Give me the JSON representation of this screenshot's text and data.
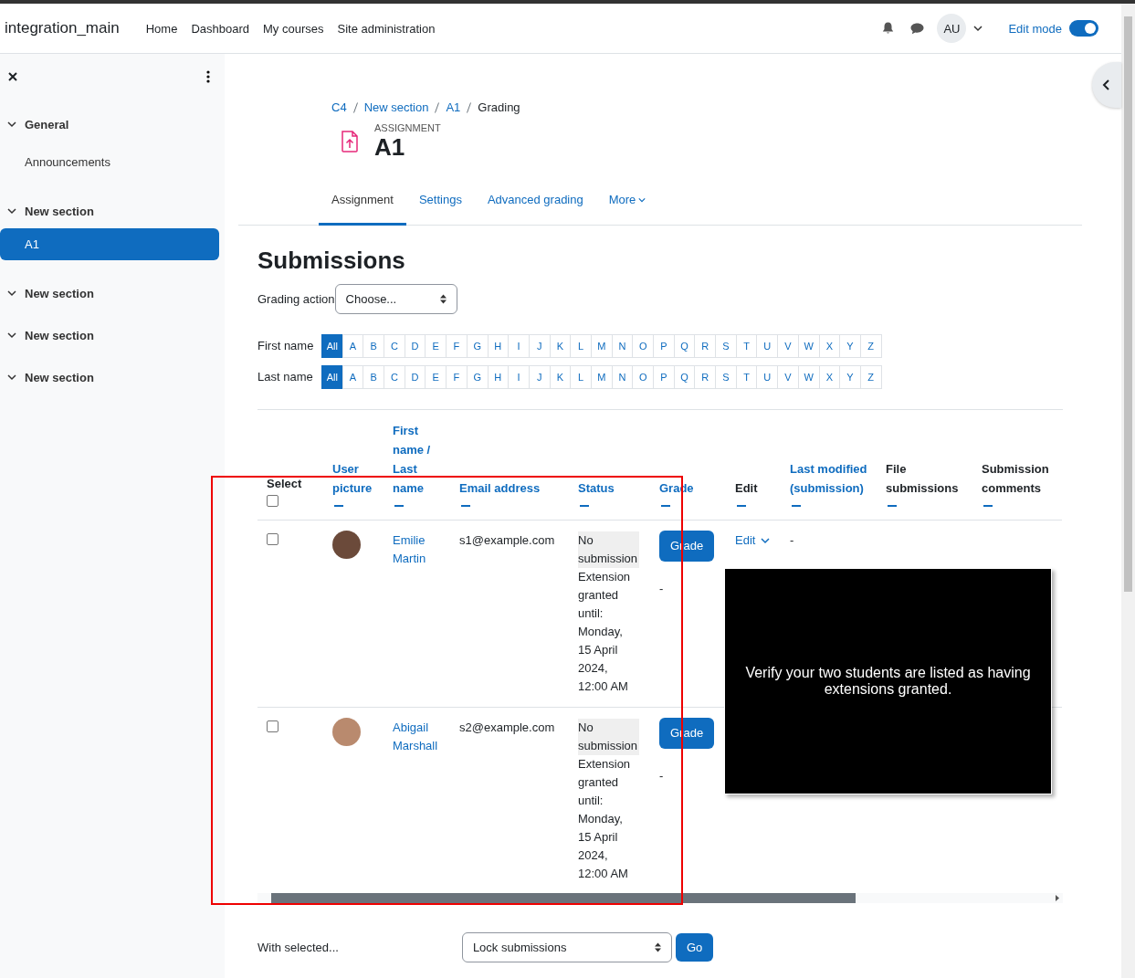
{
  "site_name": "integration_main",
  "nav": [
    "Home",
    "Dashboard",
    "My courses",
    "Site administration"
  ],
  "user_initials": "AU",
  "edit_mode": {
    "label": "Edit mode",
    "on": true
  },
  "sidebar": {
    "sections": [
      {
        "title": "General",
        "expanded": true,
        "items": [
          {
            "label": "Announcements",
            "selected": false
          }
        ]
      },
      {
        "title": "New section",
        "expanded": true,
        "items": [
          {
            "label": "A1",
            "selected": true
          }
        ]
      },
      {
        "title": "New section",
        "expanded": true
      },
      {
        "title": "New section",
        "expanded": true
      },
      {
        "title": "New section",
        "expanded": true
      }
    ]
  },
  "breadcrumb": [
    "C4",
    "New section",
    "A1",
    "Grading"
  ],
  "activity": {
    "type_label": "ASSIGNMENT",
    "title": "A1"
  },
  "tabs": [
    {
      "label": "Assignment",
      "selected": true,
      "kind": "link"
    },
    {
      "label": "Settings",
      "selected": false,
      "kind": "link"
    },
    {
      "label": "Advanced grading",
      "selected": false,
      "kind": "link"
    },
    {
      "label": "More",
      "selected": false,
      "kind": "dropdown"
    }
  ],
  "heading": "Submissions",
  "grading_action": {
    "label": "Grading action",
    "value": "Choose..."
  },
  "filters": [
    {
      "label": "First name",
      "options": [
        {
          "label": "All",
          "selected": true
        },
        {
          "label": "A",
          "selected": false
        },
        {
          "label": "B",
          "selected": false
        },
        {
          "label": "C",
          "selected": false
        },
        {
          "label": "D",
          "selected": false
        },
        {
          "label": "E",
          "selected": false
        },
        {
          "label": "F",
          "selected": false
        },
        {
          "label": "G",
          "selected": false
        },
        {
          "label": "H",
          "selected": false
        },
        {
          "label": "I",
          "selected": false
        },
        {
          "label": "J",
          "selected": false
        },
        {
          "label": "K",
          "selected": false
        },
        {
          "label": "L",
          "selected": false
        },
        {
          "label": "M",
          "selected": false
        },
        {
          "label": "N",
          "selected": false
        },
        {
          "label": "O",
          "selected": false
        },
        {
          "label": "P",
          "selected": false
        },
        {
          "label": "Q",
          "selected": false
        },
        {
          "label": "R",
          "selected": false
        },
        {
          "label": "S",
          "selected": false
        },
        {
          "label": "T",
          "selected": false
        },
        {
          "label": "U",
          "selected": false
        },
        {
          "label": "V",
          "selected": false
        },
        {
          "label": "W",
          "selected": false
        },
        {
          "label": "X",
          "selected": false
        },
        {
          "label": "Y",
          "selected": false
        },
        {
          "label": "Z",
          "selected": false
        }
      ]
    },
    {
      "label": "Last name",
      "options": [
        {
          "label": "All",
          "selected": true
        },
        {
          "label": "A",
          "selected": false
        },
        {
          "label": "B",
          "selected": false
        },
        {
          "label": "C",
          "selected": false
        },
        {
          "label": "D",
          "selected": false
        },
        {
          "label": "E",
          "selected": false
        },
        {
          "label": "F",
          "selected": false
        },
        {
          "label": "G",
          "selected": false
        },
        {
          "label": "H",
          "selected": false
        },
        {
          "label": "I",
          "selected": false
        },
        {
          "label": "J",
          "selected": false
        },
        {
          "label": "K",
          "selected": false
        },
        {
          "label": "L",
          "selected": false
        },
        {
          "label": "M",
          "selected": false
        },
        {
          "label": "N",
          "selected": false
        },
        {
          "label": "O",
          "selected": false
        },
        {
          "label": "P",
          "selected": false
        },
        {
          "label": "Q",
          "selected": false
        },
        {
          "label": "R",
          "selected": false
        },
        {
          "label": "S",
          "selected": false
        },
        {
          "label": "T",
          "selected": false
        },
        {
          "label": "U",
          "selected": false
        },
        {
          "label": "V",
          "selected": false
        },
        {
          "label": "W",
          "selected": false
        },
        {
          "label": "X",
          "selected": false
        },
        {
          "label": "Y",
          "selected": false
        },
        {
          "label": "Z",
          "selected": false
        }
      ]
    }
  ],
  "table": {
    "select_all_checked": false,
    "columns": [
      {
        "label": "Select",
        "kind": "select"
      },
      {
        "label": "User picture",
        "kind": "data",
        "sortable": true
      },
      {
        "label": "First name / Last name",
        "kind": "data",
        "sortable": true
      },
      {
        "label": "Email address",
        "kind": "data",
        "sortable": true
      },
      {
        "label": "Status",
        "kind": "data",
        "sortable": true
      },
      {
        "label": "Grade",
        "kind": "data",
        "sortable": true
      },
      {
        "label": "Edit",
        "kind": "data",
        "sortable": false
      },
      {
        "label": "Last modified (submission)",
        "kind": "data",
        "sortable": true
      },
      {
        "label": "File submissions",
        "kind": "data",
        "sortable": false
      },
      {
        "label": "Submission comments",
        "kind": "data",
        "sortable": false
      }
    ],
    "rows": [
      {
        "checked": false,
        "name": "Emilie Martin",
        "email": "s1@example.com",
        "status": "No submission",
        "status_note": "Extension granted until: Monday, 15 April 2024, 12:00 AM",
        "grade_button": "Grade",
        "grade": "-",
        "edit": "Edit",
        "last_modified": "-"
      },
      {
        "checked": false,
        "name": "Abigail Marshall",
        "email": "s2@example.com",
        "status": "No submission",
        "status_note": "Extension granted until: Monday, 15 April 2024, 12:00 AM",
        "grade_button": "Grade",
        "grade": "-"
      }
    ]
  },
  "bulk": {
    "label": "With selected...",
    "value": "Lock submissions",
    "button": "Go"
  },
  "overlay_caption": "Verify your two students are listed as having extensions granted."
}
